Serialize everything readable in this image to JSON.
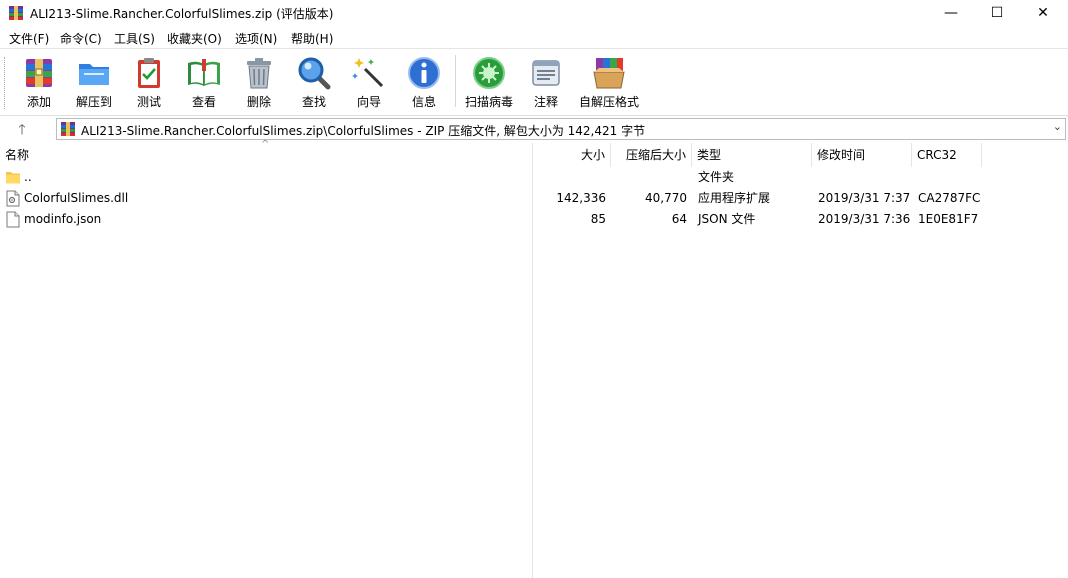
{
  "window": {
    "title": "ALI213-Slime.Rancher.ColorfulSlimes.zip (评估版本)",
    "minimize": "—",
    "maximize": "☐",
    "close": "✕"
  },
  "menu": [
    {
      "label": "文件(F)"
    },
    {
      "label": "命令(C)"
    },
    {
      "label": "工具(S)"
    },
    {
      "label": "收藏夹(O)"
    },
    {
      "label": "选项(N)"
    },
    {
      "label": "帮助(H)"
    }
  ],
  "toolbar": [
    {
      "label": "添加",
      "icon": "add-archive-icon"
    },
    {
      "label": "解压到",
      "icon": "extract-to-icon"
    },
    {
      "label": "测试",
      "icon": "test-icon"
    },
    {
      "label": "查看",
      "icon": "view-icon"
    },
    {
      "label": "删除",
      "icon": "delete-icon"
    },
    {
      "label": "查找",
      "icon": "find-icon"
    },
    {
      "label": "向导",
      "icon": "wizard-icon"
    },
    {
      "label": "信息",
      "icon": "info-icon"
    },
    {
      "label": "扫描病毒",
      "icon": "virus-scan-icon"
    },
    {
      "label": "注释",
      "icon": "comment-icon"
    },
    {
      "label": "自解压格式",
      "icon": "sfx-icon"
    }
  ],
  "address": {
    "up": "🡑",
    "path": "ALI213-Slime.Rancher.ColorfulSlimes.zip\\ColorfulSlimes - ZIP 压缩文件, 解包大小为 142,421 字节",
    "dropdown": "⌄"
  },
  "columns": {
    "name": "名称",
    "size": "大小",
    "packed": "压缩后大小",
    "type": "类型",
    "modified": "修改时间",
    "crc": "CRC32"
  },
  "files": [
    {
      "name": "..",
      "size": "",
      "packed": "",
      "type": "文件夹",
      "modified": "",
      "crc": "",
      "icon": "folder-icon"
    },
    {
      "name": "ColorfulSlimes.dll",
      "size": "142,336",
      "packed": "40,770",
      "type": "应用程序扩展",
      "modified": "2019/3/31 7:37",
      "crc": "CA2787FC",
      "icon": "dll-file-icon"
    },
    {
      "name": "modinfo.json",
      "size": "85",
      "packed": "64",
      "type": "JSON 文件",
      "modified": "2019/3/31 7:36",
      "crc": "1E0E81F7",
      "icon": "file-icon"
    }
  ]
}
